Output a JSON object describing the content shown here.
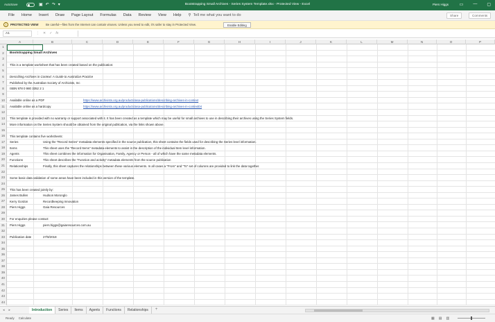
{
  "titlebar": {
    "autosave": "AutoSave",
    "title": "Bootstrapping Small Archives - Series System Template.xlsx  -  Protected View  -  Excel",
    "user": "Piers Higgs",
    "min": "—",
    "restore": "▢"
  },
  "menu": {
    "items": [
      "File",
      "Home",
      "Insert",
      "Draw",
      "Page Layout",
      "Formulas",
      "Data",
      "Review",
      "View",
      "Help"
    ],
    "tell_me": "Tell me what you want to do",
    "share": "Share",
    "comments": "Comments"
  },
  "protected": {
    "label": "PROTECTED VIEW",
    "message": "Be careful—files from the Internet can contain viruses. Unless you need to edit, it's safer to stay in Protected View.",
    "button": "Enable Editing"
  },
  "formula": {
    "namebox": "A1",
    "fx": "fx"
  },
  "columns": [
    "A",
    "B",
    "C",
    "D",
    "E",
    "F",
    "G",
    "H",
    "I",
    "J",
    "K",
    "L",
    "M",
    "N",
    "O",
    "P"
  ],
  "rows": [
    {
      "n": "1",
      "a": "",
      "b": "",
      "c": ""
    },
    {
      "n": "2",
      "a": "Bootstrapping Small Archives",
      "b": "",
      "c": "",
      "bold": true
    },
    {
      "n": "3",
      "a": "",
      "b": "",
      "c": ""
    },
    {
      "n": "4",
      "a": "This is a template worksheet that has been created based on the publication:",
      "b": "",
      "c": ""
    },
    {
      "n": "5",
      "a": "",
      "b": "",
      "c": ""
    },
    {
      "n": "6",
      "a": "Describing Archives in Context:  A Guide to Australian Practice",
      "b": "",
      "c": "",
      "italic": true
    },
    {
      "n": "7",
      "a": "Published by the Australian Society of Archivists, Inc",
      "b": "",
      "c": ""
    },
    {
      "n": "8",
      "a": "ISBN 978 0 980 3352 2 1",
      "b": "",
      "c": ""
    },
    {
      "n": "9",
      "a": "",
      "b": "",
      "c": ""
    },
    {
      "n": "10",
      "a": "Available online as a PDF",
      "b": "",
      "c": "https://www.archivists.org.au/products/asa-publications/describing-archives-in-context"
    },
    {
      "n": "11",
      "a": "Available online as a hardcopy",
      "b": "",
      "c": "https://www.archivists.org.au/products/asa-publications/describing-archives-in-context04"
    },
    {
      "n": "12",
      "a": "",
      "b": "",
      "c": ""
    },
    {
      "n": "13",
      "a": "This template is provided with no warranty or support associated with it.  It has been created as a template which may be useful for small archives to use in describing their archives using the Series System fields.",
      "b": "",
      "c": ""
    },
    {
      "n": "14",
      "a": "More information on the Series System should be obtained from the original publication, via the links shown above.",
      "b": "",
      "c": ""
    },
    {
      "n": "15",
      "a": "",
      "b": "",
      "c": ""
    },
    {
      "n": "16",
      "a": "This template contains five worksheets:",
      "b": "",
      "c": ""
    },
    {
      "n": "17",
      "a": "Series",
      "b": "Using the \"Record Series\" metadata elements specified in the source publication, this sheet contains the fields used for describing the Series level information.",
      "c": ""
    },
    {
      "n": "18",
      "a": "Items",
      "b": "This sheet uses the \"Record Items\" metadata elements to assist in the description of the individual Item level information.",
      "c": ""
    },
    {
      "n": "19",
      "a": "Agents",
      "b": "This sheet combines the information for Organisation, Family, Agency or Person - all of which have the same metadata elements.",
      "c": ""
    },
    {
      "n": "20",
      "a": "Functions",
      "b": "This sheet describes the \"Function and activity\" metadata elements from the source publication",
      "c": ""
    },
    {
      "n": "21",
      "a": "Relationships",
      "b": "Finally, this sheet captures the relationships between these various elements.  In all cases a \"From\" and \"To\" set of columns are provided to link the data together.",
      "c": ""
    },
    {
      "n": "22",
      "a": "",
      "b": "",
      "c": ""
    },
    {
      "n": "23",
      "a": "Some basic data validation of some areas have been included in this version of the template.",
      "b": "",
      "c": ""
    },
    {
      "n": "24",
      "a": "",
      "b": "",
      "c": ""
    },
    {
      "n": "25",
      "a": "This has been created jointly by:",
      "b": "",
      "c": ""
    },
    {
      "n": "26",
      "a": "James Bullen",
      "b": "Hudson Moronglo",
      "c": ""
    },
    {
      "n": "27",
      "a": "Kerry Gordon",
      "b": "Recordkeeping Innovation",
      "c": ""
    },
    {
      "n": "28",
      "a": "Piers Higgs",
      "b": "Gaia Resources",
      "c": ""
    },
    {
      "n": "29",
      "a": "",
      "b": "",
      "c": ""
    },
    {
      "n": "30",
      "a": "For enquiries please contact:",
      "b": "",
      "c": ""
    },
    {
      "n": "31",
      "a": "Piers Higgs",
      "b": "piers.higgs@gaiaresources.com.au",
      "c": ""
    },
    {
      "n": "32",
      "a": "",
      "b": "",
      "c": ""
    },
    {
      "n": "33",
      "a": "Publication date",
      "b": "27/9/2018",
      "c": ""
    },
    {
      "n": "34",
      "a": "",
      "b": "",
      "c": ""
    },
    {
      "n": "35",
      "a": "",
      "b": "",
      "c": ""
    },
    {
      "n": "36",
      "a": "",
      "b": "",
      "c": ""
    },
    {
      "n": "37",
      "a": "",
      "b": "",
      "c": ""
    },
    {
      "n": "38",
      "a": "",
      "b": "",
      "c": ""
    },
    {
      "n": "39",
      "a": "",
      "b": "",
      "c": ""
    },
    {
      "n": "40",
      "a": "",
      "b": "",
      "c": ""
    },
    {
      "n": "41",
      "a": "",
      "b": "",
      "c": ""
    },
    {
      "n": "42",
      "a": "",
      "b": "",
      "c": ""
    },
    {
      "n": "43",
      "a": "",
      "b": "",
      "c": ""
    },
    {
      "n": "44",
      "a": "",
      "b": "",
      "c": ""
    }
  ],
  "sheets": {
    "tabs": [
      "Introduction",
      "Series",
      "Items",
      "Agents",
      "Functions",
      "Relationships"
    ],
    "active": "Introduction",
    "add": "+"
  },
  "status": {
    "ready": "Ready",
    "calc": "Calculate"
  },
  "colors": {
    "accent": "#217346",
    "link": "#2e5cb8",
    "warning_bg": "#fff4ce"
  }
}
